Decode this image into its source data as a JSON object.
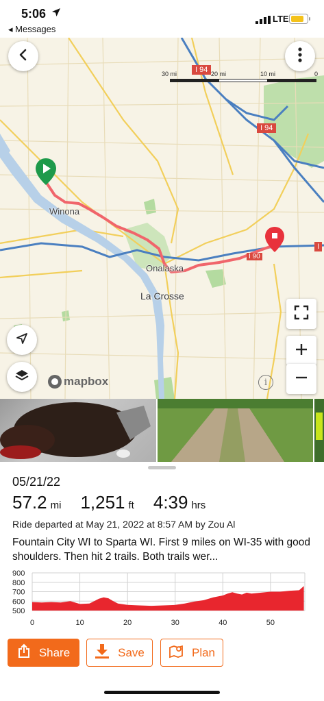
{
  "status_bar": {
    "time": "5:06",
    "back_app": "◂ Messages",
    "network": "LTE"
  },
  "map": {
    "scale_labels": [
      "30 mi",
      "20 mi",
      "10 mi",
      "0"
    ],
    "highway_labels": [
      "I 94",
      "I 94",
      "I",
      "I 90"
    ],
    "place_labels": [
      "Winona",
      "Onalaska",
      "La Crosse"
    ],
    "attribution": "mapbox",
    "info_symbol": "i",
    "colors": {
      "route": "#f0656b",
      "start": "#1e9a4b",
      "end": "#e8323c",
      "water": "#b7d0e8",
      "park": "#b4dba0"
    }
  },
  "sheet": {
    "date": "05/21/22",
    "stats": [
      {
        "value": "57.2",
        "unit": "mi"
      },
      {
        "value": "1,251",
        "unit": "ft"
      },
      {
        "value": "4:39",
        "unit": "hrs"
      }
    ],
    "ride_meta": "Ride departed at May 21, 2022 at 8:57 AM by Zou Al",
    "description": "Fountain City WI to Sparta WI.  First 9 miles on WI-35 with good shoulders.  Then hit 2 trails.  Both trails wer..."
  },
  "chart_data": {
    "type": "area",
    "x": [
      0,
      2,
      4,
      6,
      8,
      10,
      12,
      13,
      14,
      15,
      16,
      17,
      18,
      20,
      22,
      25,
      28,
      30,
      32,
      34,
      36,
      38,
      39,
      40,
      41,
      42,
      43,
      44,
      45,
      46,
      48,
      50,
      52,
      54,
      56,
      57
    ],
    "y": [
      590,
      585,
      590,
      585,
      600,
      570,
      575,
      600,
      625,
      640,
      630,
      600,
      575,
      560,
      555,
      550,
      555,
      560,
      575,
      595,
      610,
      640,
      650,
      660,
      680,
      695,
      680,
      670,
      690,
      680,
      690,
      700,
      700,
      710,
      715,
      760
    ],
    "xticks": [
      0,
      10,
      20,
      30,
      40,
      50
    ],
    "yticks": [
      500,
      600,
      700,
      800,
      900
    ],
    "xlim": [
      0,
      57.2
    ],
    "ylim": [
      500,
      900
    ],
    "grid": true,
    "color": "#e8262e"
  },
  "actions": {
    "share": "Share",
    "save": "Save",
    "plan": "Plan",
    "accent": "#f26a1b"
  }
}
